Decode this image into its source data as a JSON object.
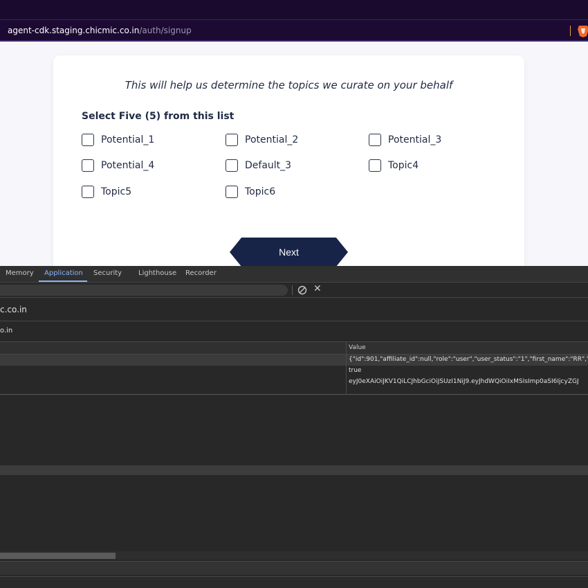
{
  "browser": {
    "url_host": "agent-cdk.staging.chicmic.co.in",
    "url_path": "/auth/signup"
  },
  "page": {
    "headline": "This will help us determine the topics we curate on your behalf",
    "select_label": "Select Five (5) from this list",
    "options": [
      "Potential_1",
      "Potential_2",
      "Potential_3",
      "Potential_4",
      "Default_3",
      "Topic4",
      "Topic5",
      "Topic6"
    ],
    "next_label": "Next"
  },
  "devtools": {
    "tabs": [
      "Memory",
      "Application",
      "Security",
      "Lighthouse",
      "Recorder"
    ],
    "active_tab": "Application",
    "origin": "c.co.in",
    "domain": "o.in",
    "value_header": "Value",
    "values": [
      "{\"id\":901,\"affiliate_id\":null,\"role\":\"user\",\"user_status\":\"1\",\"first_name\":\"RR\",\"l",
      "true",
      "eyJ0eXAiOiJKV1QiLCJhbGciOiJSUzI1NiJ9.eyJhdWQiOiIxMSIsImp0aSI6IjcyZGJ"
    ],
    "accent_color": "#8ab4f8"
  }
}
